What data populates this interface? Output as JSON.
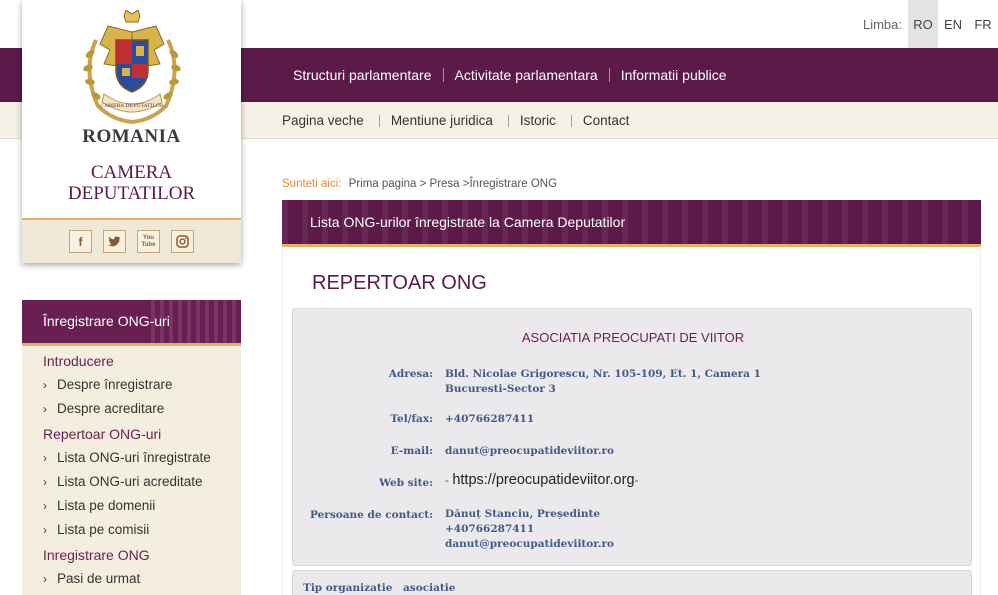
{
  "language": {
    "label": "Limba:",
    "options": [
      "RO",
      "EN",
      "FR"
    ],
    "selected": "RO"
  },
  "logo": {
    "country": "ROMANIA",
    "institution_line1": "CAMERA",
    "institution_line2": "DEPUTATILOR",
    "crest_text": "CAMERA DEPUTATILOR",
    "social": [
      "f",
      "t",
      "You Tube",
      "ig"
    ]
  },
  "main_menu": [
    "Structuri parlamentare",
    "Activitate parlamentara",
    "Informatii publice"
  ],
  "sub_menu": [
    "Pagina veche",
    "Mentiune juridica",
    "Istoric",
    "Contact"
  ],
  "breadcrumb": {
    "lead": "Sunteti aici:",
    "path": "Prima pagina > Presa >Înregistrare ONG"
  },
  "sidebar": {
    "header": "Înregistrare ONG-uri",
    "sections": [
      {
        "title": "Introducere",
        "items": [
          "Despre înregistrare",
          "Despre acreditare"
        ]
      },
      {
        "title": "Repertoar ONG-uri",
        "items": [
          "Lista ONG-uri înregistrate",
          "Lista ONG-uri acreditate",
          "Lista pe domenii",
          "Lista pe comisii"
        ]
      },
      {
        "title": "Inregistrare ONG",
        "items": [
          "Pasi de urmat"
        ]
      }
    ]
  },
  "content": {
    "header": "Lista ONG-urilor înregistrate la Camera Deputatilor",
    "title": "REPERTOAR ONG",
    "org": {
      "name": "ASOCIATIA PREOCUPATI DE VIITOR",
      "address_label": "Adresa:",
      "address_line1": "Bld. Nicolae Grigorescu, Nr. 105-109, Et. 1, Camera 1",
      "address_line2": "Bucuresti-Sector 3",
      "phone_label": "Tel/fax:",
      "phone": "+40766287411",
      "email_label": "E-mail:",
      "email": "danut@preocupatideviitor.ro",
      "web_label": "Web site:",
      "web_prefix": "- ",
      "web": "https://preocupatideviitor.org",
      "web_suffix": "-",
      "contact_label": "Persoane de contact:",
      "contact_name": "Dănuț Stanciu, Președinte",
      "contact_phone": "+40766287411",
      "contact_email": "danut@preocupatideviitor.ro"
    },
    "type_label": "Tip organizatie",
    "type_value": "asociatie"
  },
  "colors": {
    "brand_purple": "#5b1a48",
    "accent_gold": "#e0b264",
    "beige": "#f6f1e6",
    "label_blue": "#3f5a8a",
    "breadcrumb_orange": "#e28a3a"
  }
}
